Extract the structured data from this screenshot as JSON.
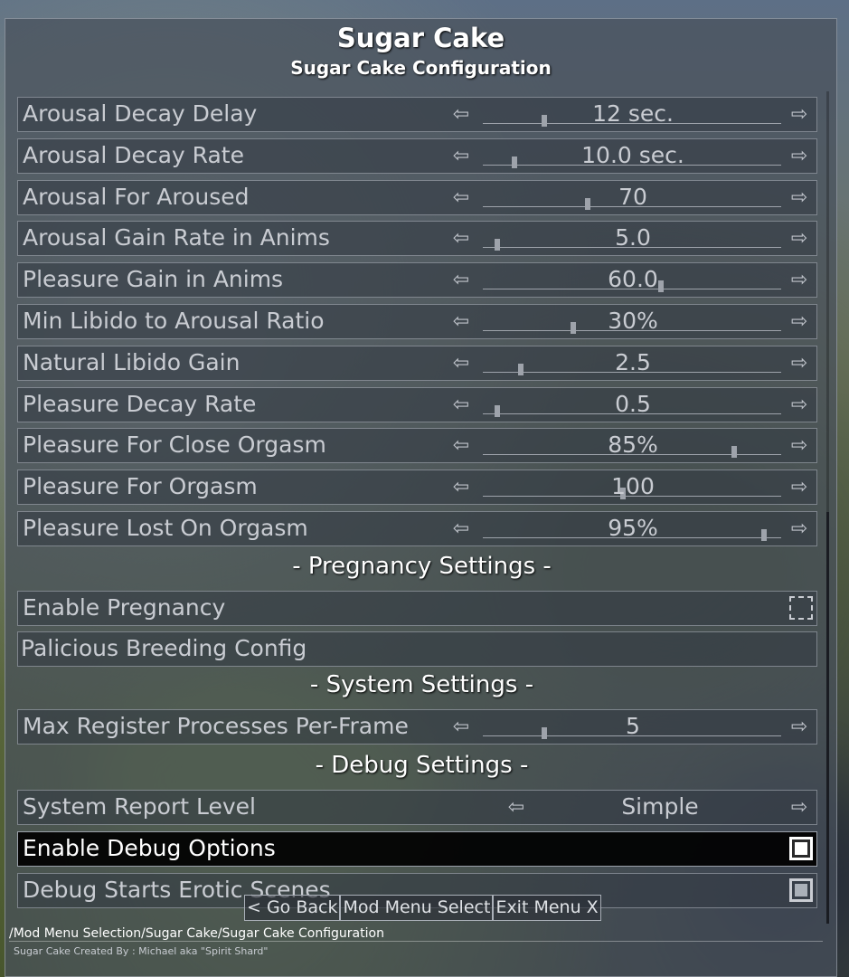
{
  "header": {
    "title": "Sugar Cake",
    "subtitle": "Sugar Cake Configuration"
  },
  "sliders": [
    {
      "label": "Arousal Decay Delay",
      "value": "12 sec.",
      "level": 0.2
    },
    {
      "label": "Arousal Decay Rate",
      "value": "10.0 sec.",
      "level": 0.1
    },
    {
      "label": "Arousal For Aroused",
      "value": "70",
      "level": 0.35
    },
    {
      "label": "Arousal Gain Rate in Anims",
      "value": "5.0",
      "level": 0.04
    },
    {
      "label": "Pleasure Gain in Anims",
      "value": "60.0",
      "level": 0.6
    },
    {
      "label": "Min Libido to Arousal Ratio",
      "value": "30%",
      "level": 0.3
    },
    {
      "label": "Natural Libido Gain",
      "value": "2.5",
      "level": 0.12
    },
    {
      "label": "Pleasure Decay Rate",
      "value": "0.5",
      "level": 0.04
    },
    {
      "label": "Pleasure For Close Orgasm",
      "value": "85%",
      "level": 0.85
    },
    {
      "label": "Pleasure For Orgasm",
      "value": "100",
      "level": 0.47
    },
    {
      "label": "Pleasure Lost On Orgasm",
      "value": "95%",
      "level": 0.95
    }
  ],
  "sections": {
    "pregnancy": "- Pregnancy Settings -",
    "system": "- System Settings -",
    "debug": "- Debug Settings -"
  },
  "pregnancy": {
    "enable_label": "Enable Pregnancy",
    "enable_checked": false,
    "breeding_label": "Palicious Breeding Config"
  },
  "system": {
    "label": "Max Register Processes Per-Frame",
    "value": "5",
    "level": 0.2
  },
  "debug": {
    "report_label": "System Report Level",
    "report_value": "Simple",
    "debug_options_label": "Enable Debug Options",
    "debug_options_checked": true,
    "erotic_label": "Debug Starts Erotic Scenes",
    "erotic_checked": true
  },
  "nav": {
    "back": "< Go Back",
    "mod_menu": "Mod Menu Select",
    "exit": "Exit Menu X"
  },
  "breadcrumb": "/Mod Menu Selection/Sugar Cake/Sugar Cake Configuration",
  "credit": "Sugar Cake Created By : Michael aka \"Spirit Shard\"",
  "icons": {
    "left": "arrow-left-icon",
    "right": "arrow-right-icon",
    "checkbox": "checkbox-icon"
  }
}
